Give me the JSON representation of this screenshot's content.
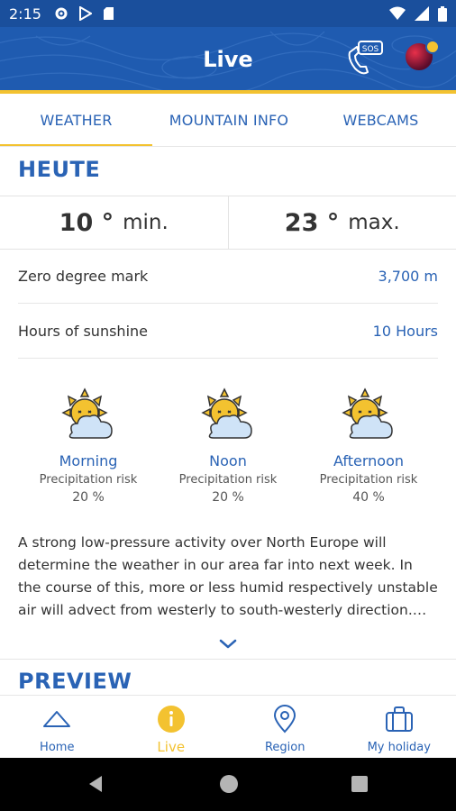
{
  "status_bar": {
    "time": "2:15",
    "icons": [
      "gear-icon",
      "play-store-icon",
      "sd-card-icon",
      "wifi-icon",
      "signal-icon",
      "battery-icon"
    ]
  },
  "app_bar": {
    "title": "Live",
    "sos_label": "SOS",
    "colors": {
      "background": "#1f5bb0",
      "accent": "#f3c230"
    }
  },
  "tabs": [
    {
      "label": "WEATHER",
      "active": true
    },
    {
      "label": "MOUNTAIN INFO",
      "active": false
    },
    {
      "label": "WEBCAMS",
      "active": false
    }
  ],
  "today": {
    "title": "HEUTE",
    "min_value": "10 °",
    "min_label": "min.",
    "max_value": "23 °",
    "max_label": "max.",
    "zero_degree_label": "Zero degree mark",
    "zero_degree_value": "3,700 m",
    "sunshine_label": "Hours of sunshine",
    "sunshine_value": "10 Hours"
  },
  "periods": [
    {
      "name": "Morning",
      "risk_label": "Precipitation risk",
      "risk_value": "20 %",
      "icon": "sun-cloud-icon"
    },
    {
      "name": "Noon",
      "risk_label": "Precipitation risk",
      "risk_value": "20 %",
      "icon": "sun-cloud-icon"
    },
    {
      "name": "Afternoon",
      "risk_label": "Precipitation risk",
      "risk_value": "40 %",
      "icon": "sun-cloud-icon"
    }
  ],
  "description": "A strong low-pressure activity over North Europe will determine the weather in our area far into next week. In the course of this, more or less humid respectively unstable air will advect from westerly to south-westerly direction. Considerable cloudiness and showers are to be expected.",
  "preview_title": "PREVIEW",
  "bottom_nav": [
    {
      "label": "Home",
      "icon": "mountain-icon",
      "active": false
    },
    {
      "label": "Live",
      "icon": "info-icon",
      "active": true
    },
    {
      "label": "Region",
      "icon": "location-pin-icon",
      "active": false
    },
    {
      "label": "My holiday",
      "icon": "suitcase-icon",
      "active": false
    }
  ]
}
